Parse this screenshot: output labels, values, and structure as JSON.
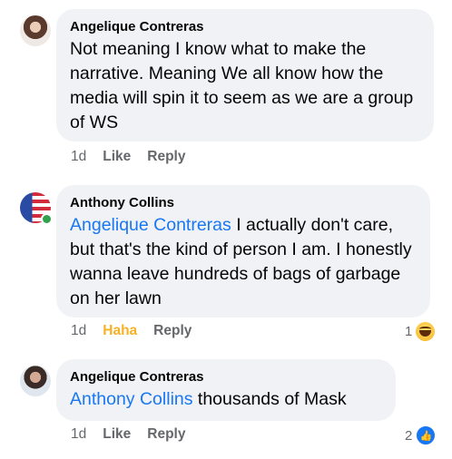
{
  "comments": [
    {
      "author": "Angelique Contreras",
      "mention": "",
      "text": "Not meaning I know what to make the narrative. Meaning We all know how the media will spin it to seem as we are a group of WS",
      "time": "1d",
      "reaction_label": "Like",
      "reply_label": "Reply",
      "reaction_count": ""
    },
    {
      "author": "Anthony Collins",
      "mention": "Angelique Contreras",
      "text": " I actually don't care, but that's the kind of person I am. I honestly wanna leave hundreds of bags of garbage on her lawn",
      "time": "1d",
      "reaction_label": "Haha",
      "reply_label": "Reply",
      "reaction_count": "1",
      "reaction_icon": "haha-emoji-icon"
    },
    {
      "author": "Angelique Contreras",
      "mention": "Anthony Collins",
      "text": " thousands of Mask",
      "time": "1d",
      "reaction_label": "Like",
      "reply_label": "Reply",
      "reaction_count": "2",
      "reaction_icon": "like-thumb-icon"
    }
  ],
  "colors": {
    "mention": "#1877f2",
    "bubble": "#f0f2f5",
    "haha": "#f7b125",
    "online": "#31a24c"
  }
}
